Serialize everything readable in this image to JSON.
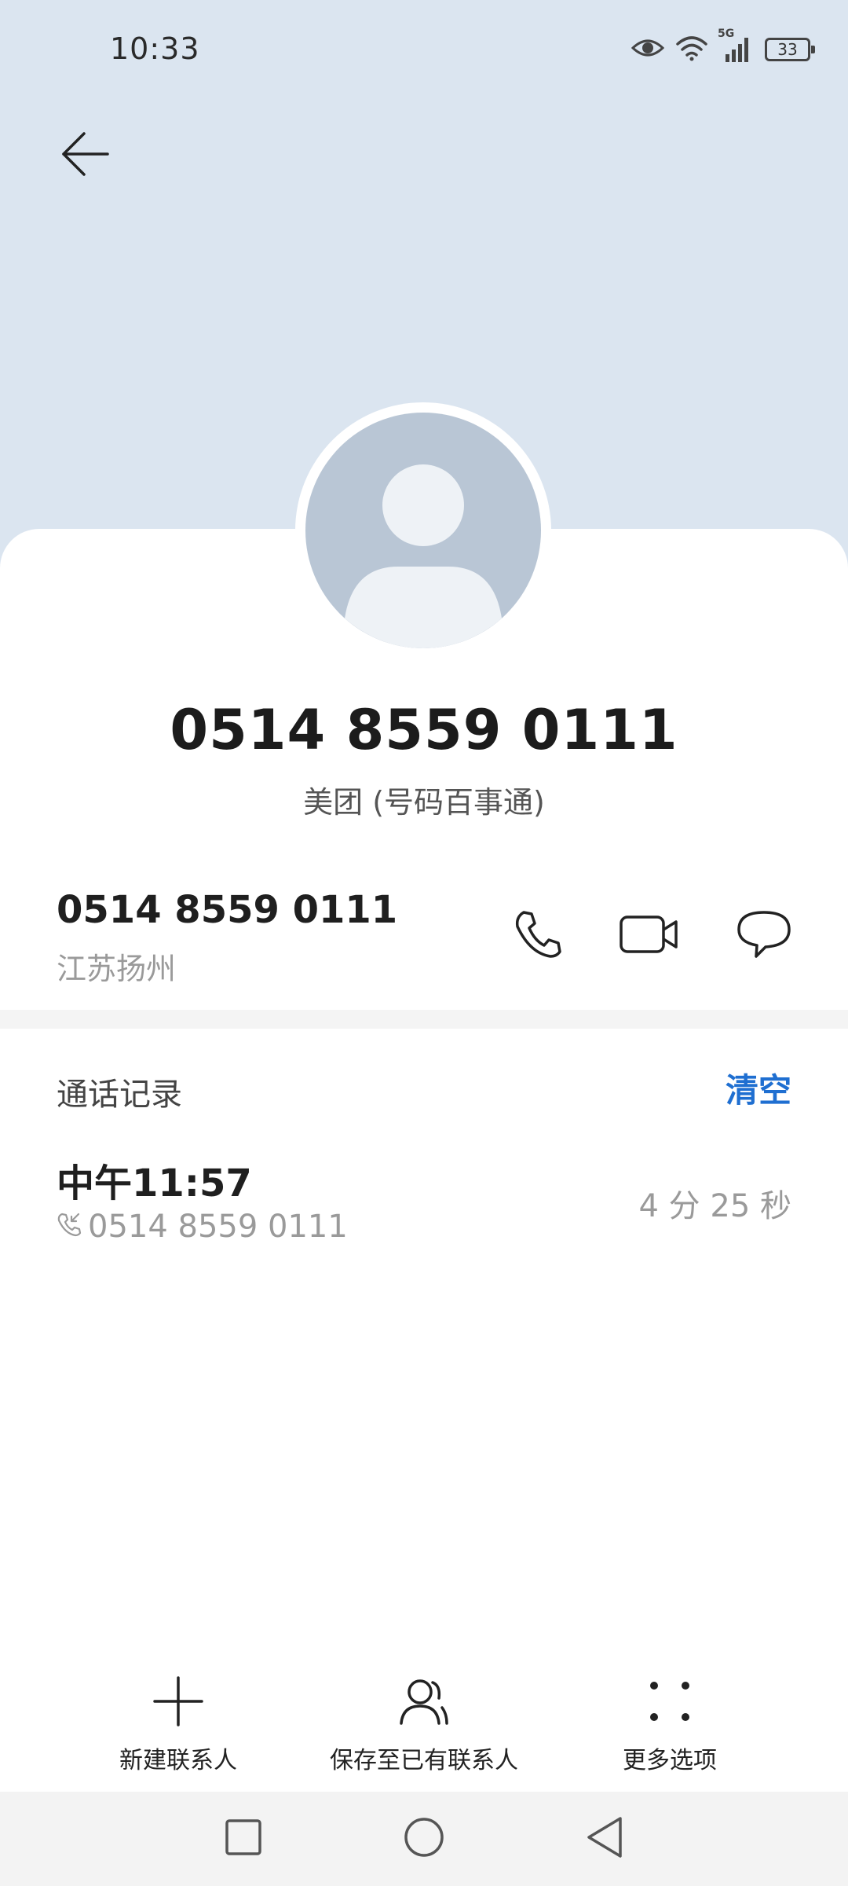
{
  "status_bar": {
    "time": "10:33",
    "network": "5G",
    "battery": "33"
  },
  "header": {
    "back_icon": "arrow-left-icon"
  },
  "contact": {
    "title_number": "0514 8559 0111",
    "subtitle": "美团 (号码百事通)",
    "avatar_icon": "person-icon"
  },
  "number_row": {
    "number": "0514 8559 0111",
    "location": "江苏扬州",
    "actions": [
      "phone-icon",
      "video-call-icon",
      "message-icon"
    ]
  },
  "call_log": {
    "title": "通话记录",
    "clear_label": "清空",
    "items": [
      {
        "time": "中午11:57",
        "number": "0514 8559 0111",
        "duration": "4 分 25 秒",
        "type_icon": "incoming-call-icon"
      }
    ]
  },
  "bottom_actions": [
    {
      "label": "新建联系人",
      "icon": "plus-icon"
    },
    {
      "label": "保存至已有联系人",
      "icon": "person-add-icon"
    },
    {
      "label": "更多选项",
      "icon": "more-dots-icon"
    }
  ],
  "colors": {
    "header_bg": "#dbe5f0",
    "accent": "#1f6fd1",
    "avatar_bg": "#b9c6d5"
  }
}
